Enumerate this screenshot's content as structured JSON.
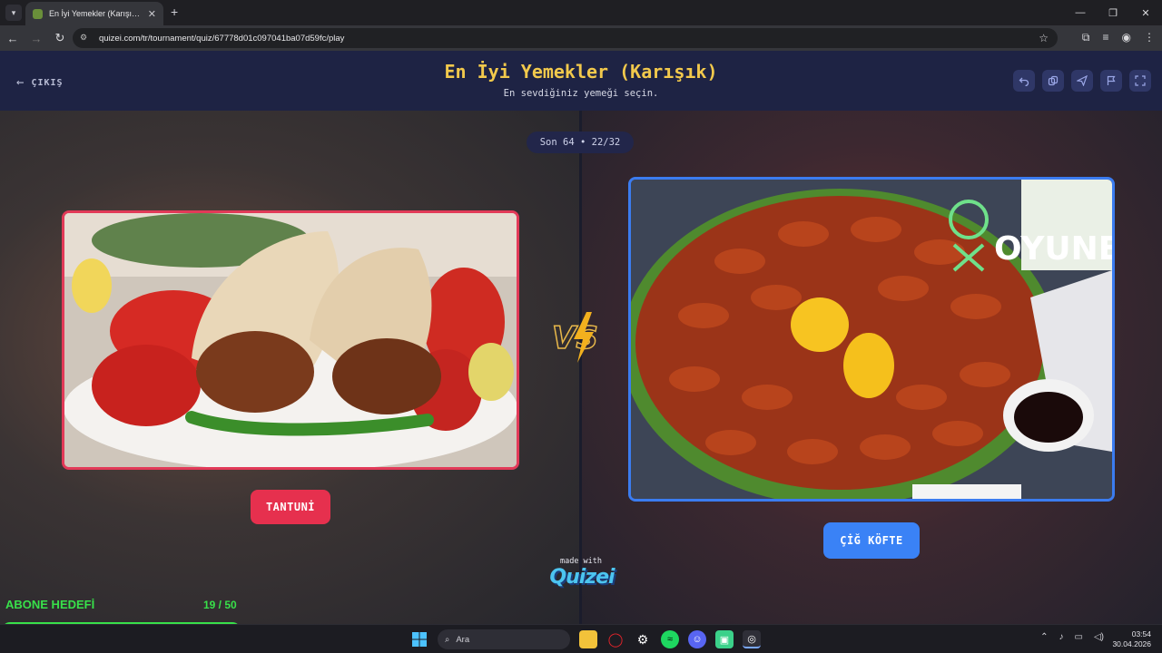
{
  "browser": {
    "tab_title": "En İyi Yemekler (Karışık) - Tier L...",
    "url": "quizei.com/tr/tournament/quiz/67778d01c097041ba07d59fc/play"
  },
  "header": {
    "exit_label": "ÇIKIŞ",
    "title": "En İyi Yemekler (Karışık)",
    "subtitle": "En sevdiğiniz yemeği seçin."
  },
  "round": {
    "label": "Son 64 • 22/32"
  },
  "left": {
    "name": "TANTUNİ"
  },
  "right": {
    "name": "ÇİĞ KÖFTE",
    "watermark": "OYUNEKS"
  },
  "branding": {
    "made_with": "made with",
    "logo": "Quizei"
  },
  "goal": {
    "label": "ABONE HEDEFİ",
    "count": "19 / 50",
    "progress": 0.38
  },
  "taskbar": {
    "search": "Ara",
    "time": "03:54",
    "date": "30.04.2026"
  },
  "colors": {
    "accent_left": "#e6304e",
    "accent_right": "#3a82f6",
    "title": "#f2c94c",
    "goal": "#38e04a"
  }
}
